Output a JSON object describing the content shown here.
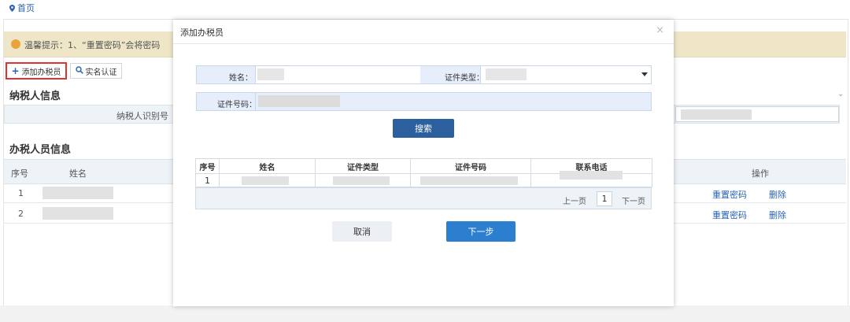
{
  "breadcrumb": {
    "home": "首页"
  },
  "notice": {
    "text": "温馨提示：1、“重置密码”会将密码"
  },
  "toolbar": {
    "add_label": "添加办税员",
    "auth_label": "实名认证"
  },
  "taxpayer_section": {
    "title": "纳税人信息",
    "id_label": "纳税人识别号"
  },
  "staff_section": {
    "title": "办税人员信息",
    "columns": {
      "seq": "序号",
      "name": "姓名",
      "ops": "操作"
    },
    "rows": [
      {
        "seq": "1",
        "reset": "重置密码",
        "delete": "删除"
      },
      {
        "seq": "2",
        "reset": "重置密码",
        "delete": "删除"
      }
    ]
  },
  "modal": {
    "title": "添加办税员",
    "close": "×",
    "name_label": "姓名：",
    "doc_type_label": "证件类型：",
    "doc_no_label": "证件号码：",
    "search_label": "搜索",
    "table": {
      "headers": [
        "序号",
        "姓名",
        "证件类型",
        "证件号码",
        "联系电话"
      ],
      "rows": [
        {
          "seq": "1"
        }
      ]
    },
    "pager": {
      "prev": "上一页",
      "current": "1",
      "next": "下一页"
    },
    "cancel_label": "取消",
    "next_label": "下一步"
  },
  "colors": {
    "primary": "#2b5f9e",
    "next": "#2b7fce",
    "link": "#2a63b5",
    "highlight": "#e0332e",
    "notice_bg": "#efe6c8"
  },
  "icons": {
    "home": "location-pin-icon",
    "add": "plus-icon",
    "auth": "search-icon",
    "warn": "warning-icon",
    "close": "close-icon",
    "dropdown": "caret-down-icon",
    "collapse": "chevron-down-icon"
  }
}
